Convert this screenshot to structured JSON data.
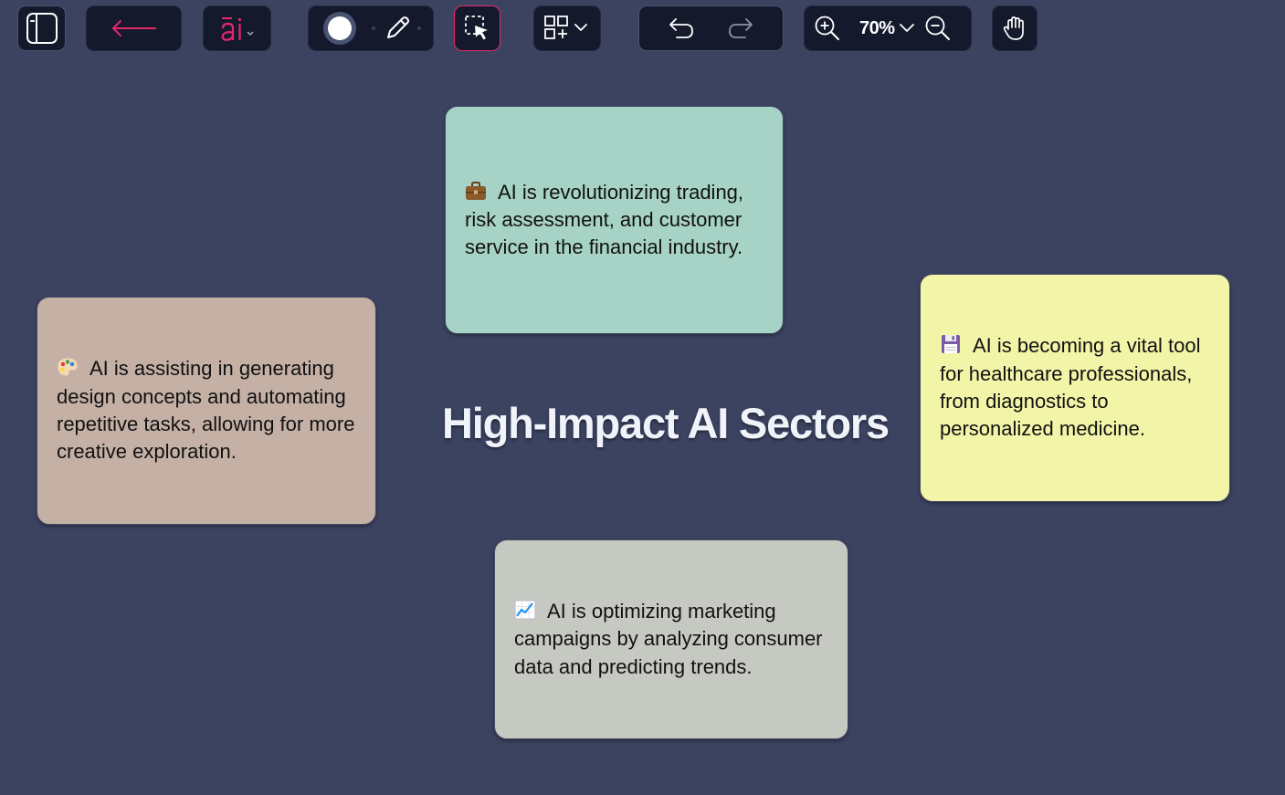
{
  "toolbar": {
    "zoom_level": "70%",
    "accent_color": "#e5286d"
  },
  "canvas": {
    "title": "High-Impact AI Sectors"
  },
  "cards": {
    "finance": {
      "icon": "briefcase-icon",
      "text": "AI is revolutionizing trading, risk assessment, and customer service in the financial industry.",
      "color": "#a6d3c5"
    },
    "design": {
      "icon": "palette-icon",
      "text": "AI is assisting in generating design concepts and automating repetitive tasks, allowing for more creative exploration.",
      "color": "#c5b0a5"
    },
    "healthcare": {
      "icon": "floppy-disk-icon",
      "text": "AI is becoming a vital tool for healthcare professionals, from diagnostics to personalized medicine.",
      "color": "#f2f5a8"
    },
    "marketing": {
      "icon": "chart-increasing-icon",
      "text": "AI is optimizing marketing campaigns by analyzing consumer data and predicting trends.",
      "color": "#c6c9c1"
    }
  }
}
